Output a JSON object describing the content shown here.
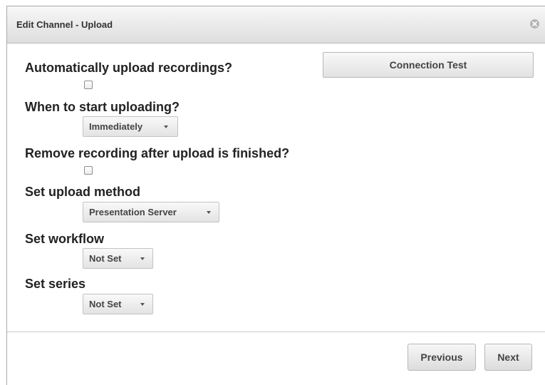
{
  "dialog": {
    "title": "Edit Channel - Upload",
    "close_icon": "close-circle-icon"
  },
  "connection_test_label": "Connection Test",
  "fields": {
    "auto_upload": {
      "label": "Automatically upload recordings?",
      "checked": false
    },
    "start_uploading": {
      "label": "When to start uploading?",
      "value": "Immediately"
    },
    "remove_after_upload": {
      "label": "Remove recording after upload is finished?",
      "checked": false
    },
    "upload_method": {
      "label": "Set upload method",
      "value": "Presentation Server"
    },
    "workflow": {
      "label": "Set workflow",
      "value": "Not Set"
    },
    "series": {
      "label": "Set series",
      "value": "Not Set"
    }
  },
  "footer": {
    "previous_label": "Previous",
    "next_label": "Next"
  }
}
